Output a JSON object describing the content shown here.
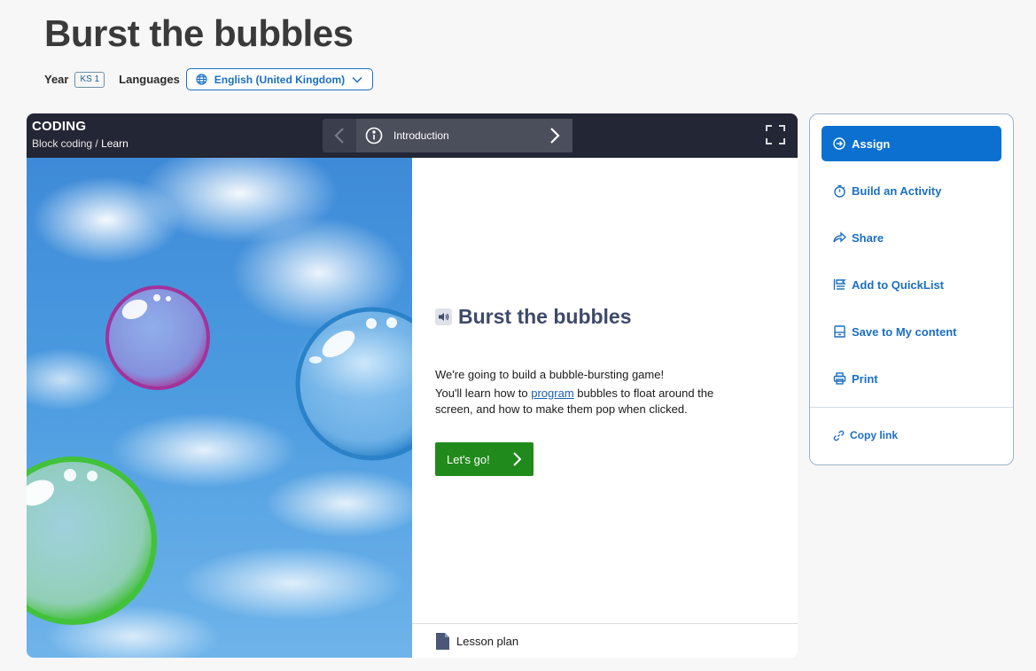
{
  "page": {
    "title": "Burst the bubbles",
    "year_label": "Year",
    "year_badge": "KS 1",
    "languages_label": "Languages",
    "language_selected": "English (United Kingdom)"
  },
  "player": {
    "subject": "CODING",
    "breadcrumb": {
      "parent": "Block coding",
      "separator": "/",
      "current": "Learn"
    },
    "nav": {
      "current_section": "Introduction"
    },
    "content": {
      "title": "Burst the bubbles",
      "line1": "We're going to build a bubble-bursting game!",
      "line2_before": "You'll learn how to ",
      "line2_link": "program",
      "line2_after": " bubbles to float around the screen, and how to make them pop when clicked.",
      "cta": "Let's go!"
    },
    "footer": {
      "lesson_plan": "Lesson plan"
    }
  },
  "sidebar": {
    "assign": "Assign",
    "items": [
      {
        "label": "Build an Activity",
        "icon": "timer-icon"
      },
      {
        "label": "Share",
        "icon": "share-icon"
      },
      {
        "label": "Add to QuickList",
        "icon": "quicklist-icon"
      },
      {
        "label": "Save to My content",
        "icon": "save-icon"
      },
      {
        "label": "Print",
        "icon": "print-icon"
      }
    ],
    "copy_link": "Copy link"
  },
  "colors": {
    "primary": "#0b70cf",
    "link": "#1a6fc2",
    "go_button": "#218a1c",
    "player_bar": "#232634",
    "title_text": "#3d4a6b"
  }
}
